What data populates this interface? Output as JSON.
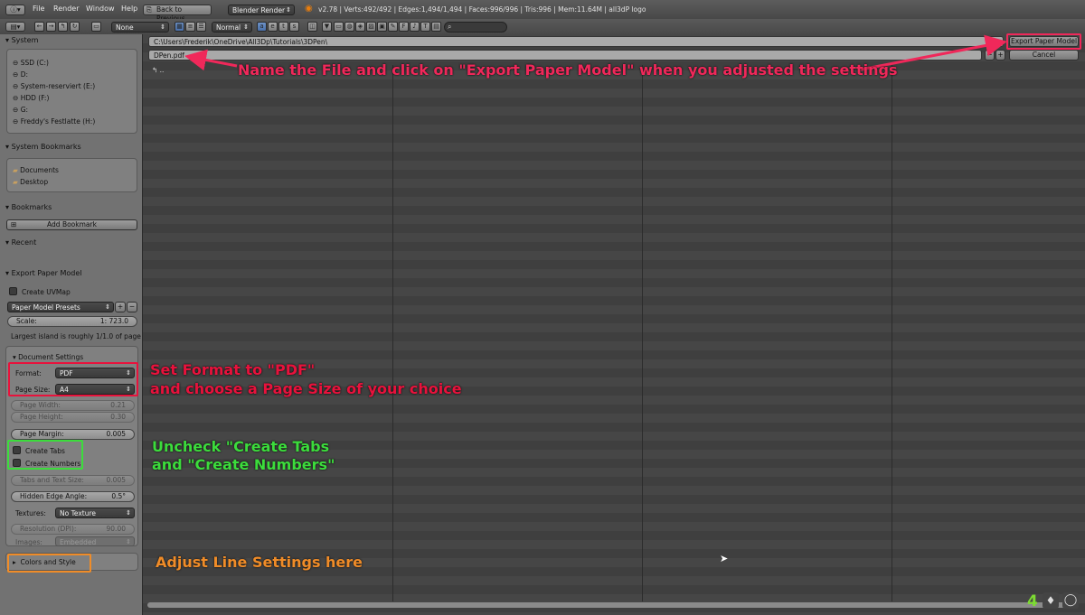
{
  "menus": [
    "File",
    "Render",
    "Window",
    "Help"
  ],
  "back_button": "Back to Previous",
  "engine": "Blender Render",
  "stats": "v2.78 | Verts:492/492 | Edges:1,494/1,494 | Faces:996/996 | Tris:996 | Mem:11.64M | all3dP logo",
  "header": {
    "none_select": "None",
    "normal_select": "Normal"
  },
  "path": "C:\\Users\\Frederik\\OneDrive\\All3Dp\\Tutorials\\3DPen\\",
  "filename": "DPen.pdf",
  "export_button": "Export Paper Model",
  "cancel_button": "Cancel",
  "parent_dir": "↰ ..",
  "sidebar": {
    "system_title": "System",
    "drives": [
      "SSD (C:)",
      "D:",
      "System-reserviert (E:)",
      "HDD (F:)",
      "G:",
      "Freddy's Festlatte (H:)"
    ],
    "bookmarks_sys_title": "System Bookmarks",
    "sys_bookmarks": [
      "Documents",
      "Desktop"
    ],
    "bookmarks_title": "Bookmarks",
    "add_bookmark": "Add Bookmark",
    "recent_title": "Recent",
    "export_title": "Export Paper Model",
    "create_uvmap": "Create UVMap",
    "presets": "Paper Model Presets",
    "scale_label": "Scale:",
    "scale_value": "1: 723.0",
    "largest_island": "Largest island is roughly 1/1.0 of page",
    "doc_settings": "Document Settings",
    "format_label": "Format:",
    "format_value": "PDF",
    "page_size_label": "Page Size:",
    "page_size_value": "A4",
    "page_width_label": "Page Width:",
    "page_width_value": "0.21",
    "page_height_label": "Page Height:",
    "page_height_value": "0.30",
    "page_margin_label": "Page Margin:",
    "page_margin_value": "0.005",
    "create_tabs": "Create Tabs",
    "create_numbers": "Create Numbers",
    "tabs_text_label": "Tabs and Text Size:",
    "tabs_text_value": "0.005",
    "hidden_edge_label": "Hidden Edge Angle:",
    "hidden_edge_value": "0.5°",
    "textures_label": "Textures:",
    "textures_value": "No Texture",
    "resolution_label": "Resolution (DPI):",
    "resolution_value": "90.00",
    "images_label": "Images:",
    "images_value": "Embedded",
    "colors_style": "Colors and Style"
  },
  "annotations": {
    "name_file": "Name the File and click on \"Export Paper Model\" when you adjusted the settings",
    "set_format_1": "Set Format to \"PDF\"",
    "set_format_2": "and choose a Page Size of your choice",
    "uncheck_1": "Uncheck \"Create Tabs",
    "uncheck_2": "and \"Create Numbers\"",
    "adjust_line": "Adjust Line Settings here"
  },
  "colors": {
    "red": "#e8123c",
    "pink": "#f0285a",
    "green": "#3cdc3c",
    "orange": "#f08c28"
  },
  "corner_number": "4"
}
